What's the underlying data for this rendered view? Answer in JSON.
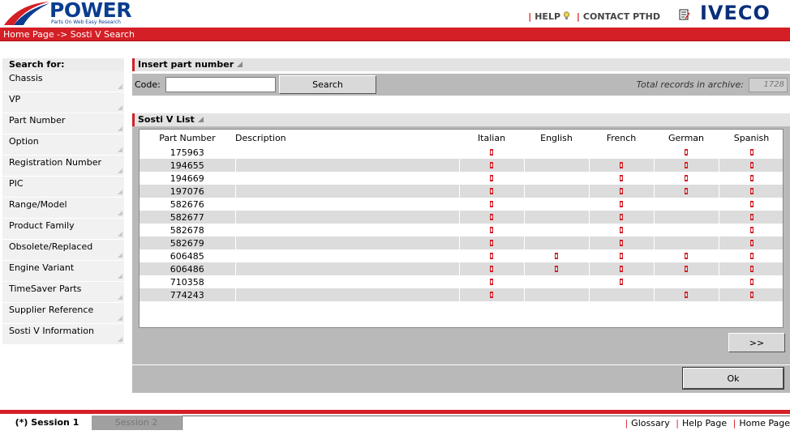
{
  "header": {
    "logo_text": "POWER",
    "logo_subtitle": "Parts On Web Easy Research",
    "help_label": "HELP",
    "contact_label": "CONTACT PTHD",
    "brand": "IVECO"
  },
  "breadcrumb": "Home Page -> Sosti V Search",
  "sidebar": {
    "heading": "Search for:",
    "items": [
      {
        "label": "Chassis"
      },
      {
        "label": "VP"
      },
      {
        "label": "Part Number"
      },
      {
        "label": "Option"
      },
      {
        "label": "Registration Number"
      },
      {
        "label": "PIC"
      },
      {
        "label": "Range/Model"
      },
      {
        "label": "Product Family"
      },
      {
        "label": "Obsolete/Replaced"
      },
      {
        "label": "Engine Variant"
      },
      {
        "label": "TimeSaver Parts"
      },
      {
        "label": "Supplier Reference"
      },
      {
        "label": "Sosti V Information"
      }
    ]
  },
  "insert_section": {
    "title": "Insert part number",
    "code_label": "Code:",
    "code_value": "",
    "search_button": "Search",
    "total_label": "Total records in archive:",
    "total_value": "1728"
  },
  "list_section": {
    "title": "Sosti V List",
    "columns": [
      "Part Number",
      "Description",
      "Italian",
      "English",
      "French",
      "German",
      "Spanish"
    ],
    "rows": [
      {
        "part": "175963",
        "desc": "",
        "langs": [
          true,
          false,
          false,
          true,
          true
        ]
      },
      {
        "part": "194655",
        "desc": "",
        "langs": [
          true,
          false,
          true,
          true,
          true
        ]
      },
      {
        "part": "194669",
        "desc": "",
        "langs": [
          true,
          false,
          true,
          true,
          true
        ]
      },
      {
        "part": "197076",
        "desc": "",
        "langs": [
          true,
          false,
          true,
          true,
          true
        ]
      },
      {
        "part": "582676",
        "desc": "",
        "langs": [
          true,
          false,
          true,
          false,
          true
        ]
      },
      {
        "part": "582677",
        "desc": "",
        "langs": [
          true,
          false,
          true,
          false,
          true
        ]
      },
      {
        "part": "582678",
        "desc": "",
        "langs": [
          true,
          false,
          true,
          false,
          true
        ]
      },
      {
        "part": "582679",
        "desc": "",
        "langs": [
          true,
          false,
          true,
          false,
          true
        ]
      },
      {
        "part": "606485",
        "desc": "",
        "langs": [
          true,
          true,
          true,
          true,
          true
        ]
      },
      {
        "part": "606486",
        "desc": "",
        "langs": [
          true,
          true,
          true,
          true,
          true
        ]
      },
      {
        "part": "710358",
        "desc": "",
        "langs": [
          true,
          false,
          true,
          false,
          true
        ]
      },
      {
        "part": "774243",
        "desc": "",
        "langs": [
          true,
          false,
          false,
          true,
          true
        ]
      }
    ],
    "flag_icon": "pdf-document-icon",
    "flag_color": "#d41f26",
    "next_button": ">>"
  },
  "ok_button": "Ok",
  "footer": {
    "tabs": [
      "(*) Session 1",
      "Session 2"
    ],
    "links": [
      "Glossary",
      "Help Page",
      "Home Page"
    ]
  },
  "colors": {
    "accent_red": "#d41f26",
    "brand_blue": "#0a2f7a",
    "panel_gray": "#b9b9b9"
  }
}
